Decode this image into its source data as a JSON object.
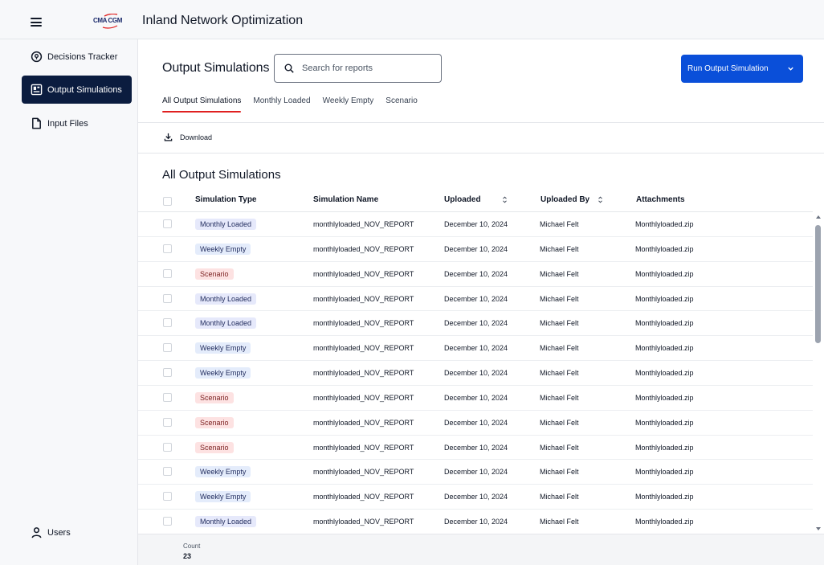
{
  "app": {
    "title": "Inland Network Optimization",
    "logo_text": "CMA CGM"
  },
  "sidebar": {
    "items": [
      {
        "label": "Decisions Tracker",
        "icon": "location-pin-icon"
      },
      {
        "label": "Output Simulations",
        "icon": "dashboard-icon",
        "active": true
      },
      {
        "label": "Input Files",
        "icon": "file-icon"
      }
    ],
    "users_label": "Users"
  },
  "page": {
    "title": "Output Simulations",
    "search_placeholder": "Search for reports",
    "run_button": "Run Output Simulation",
    "tabs": [
      "All Output Simulations",
      "Monthly Loaded",
      "Weekly Empty",
      "Scenario"
    ],
    "download_label": "Download",
    "section_title": "All Output Simulations"
  },
  "table": {
    "columns": [
      "Simulation Type",
      "Simulation Name",
      "Uploaded",
      "Uploaded By",
      "Attachments"
    ],
    "rows": [
      {
        "type": "Monthly Loaded",
        "name": "monthlyloaded_NOV_REPORT",
        "uploaded": "December 10, 2024",
        "by": "Michael Felt",
        "attachment": "Monthlyloaded.zip"
      },
      {
        "type": "Weekly Empty",
        "name": "monthlyloaded_NOV_REPORT",
        "uploaded": "December 10, 2024",
        "by": "Michael Felt",
        "attachment": "Monthlyloaded.zip"
      },
      {
        "type": "Scenario",
        "name": "monthlyloaded_NOV_REPORT",
        "uploaded": "December 10, 2024",
        "by": "Michael Felt",
        "attachment": "Monthlyloaded.zip"
      },
      {
        "type": "Monthly Loaded",
        "name": "monthlyloaded_NOV_REPORT",
        "uploaded": "December 10, 2024",
        "by": "Michael Felt",
        "attachment": "Monthlyloaded.zip"
      },
      {
        "type": "Monthly Loaded",
        "name": "monthlyloaded_NOV_REPORT",
        "uploaded": "December 10, 2024",
        "by": "Michael Felt",
        "attachment": "Monthlyloaded.zip"
      },
      {
        "type": "Weekly Empty",
        "name": "monthlyloaded_NOV_REPORT",
        "uploaded": "December 10, 2024",
        "by": "Michael Felt",
        "attachment": "Monthlyloaded.zip"
      },
      {
        "type": "Weekly Empty",
        "name": "monthlyloaded_NOV_REPORT",
        "uploaded": "December 10, 2024",
        "by": "Michael Felt",
        "attachment": "Monthlyloaded.zip"
      },
      {
        "type": "Scenario",
        "name": "monthlyloaded_NOV_REPORT",
        "uploaded": "December 10, 2024",
        "by": "Michael Felt",
        "attachment": "Monthlyloaded.zip"
      },
      {
        "type": "Scenario",
        "name": "monthlyloaded_NOV_REPORT",
        "uploaded": "December 10, 2024",
        "by": "Michael Felt",
        "attachment": "Monthlyloaded.zip"
      },
      {
        "type": "Scenario",
        "name": "monthlyloaded_NOV_REPORT",
        "uploaded": "December 10, 2024",
        "by": "Michael Felt",
        "attachment": "Monthlyloaded.zip"
      },
      {
        "type": "Weekly Empty",
        "name": "monthlyloaded_NOV_REPORT",
        "uploaded": "December 10, 2024",
        "by": "Michael Felt",
        "attachment": "Monthlyloaded.zip"
      },
      {
        "type": "Weekly Empty",
        "name": "monthlyloaded_NOV_REPORT",
        "uploaded": "December 10, 2024",
        "by": "Michael Felt",
        "attachment": "Monthlyloaded.zip"
      },
      {
        "type": "Monthly Loaded",
        "name": "monthlyloaded_NOV_REPORT",
        "uploaded": "December 10, 2024",
        "by": "Michael Felt",
        "attachment": "Monthlyloaded.zip"
      }
    ]
  },
  "footer": {
    "count_label": "Count",
    "count_value": "23"
  },
  "colors": {
    "nav_active_bg": "#0b1c3f",
    "primary_button": "#0a4fd9",
    "tab_underline": "#e02020",
    "badge_monthly": "#e6e9fb",
    "badge_weekly": "#e4ecfb",
    "badge_scenario": "#fde2e2"
  }
}
